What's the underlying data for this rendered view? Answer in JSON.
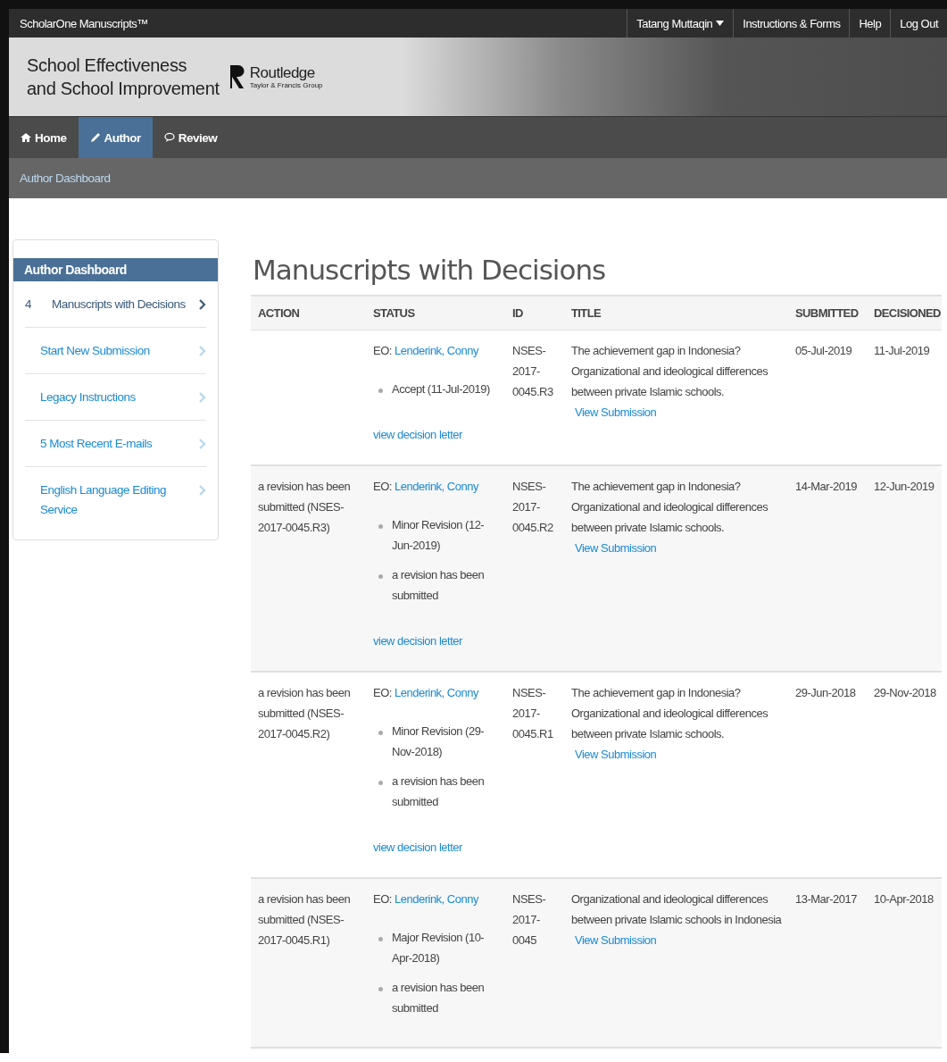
{
  "top_bar": {
    "brand": "ScholarOne Manuscripts™",
    "menu": [
      {
        "label": "Tatang Muttaqin",
        "dropdown": true
      },
      {
        "label": "Instructions & Forms",
        "dropdown": false
      },
      {
        "label": "Help",
        "dropdown": false
      },
      {
        "label": "Log Out",
        "dropdown": false
      }
    ]
  },
  "banner": {
    "journal_lines": [
      "School Effectiveness",
      "and School Improvement"
    ],
    "publisher": "Routledge",
    "publisher_group": "Taylor & Francis Group"
  },
  "nav_tabs": [
    {
      "label": "Home",
      "selected": false
    },
    {
      "label": "Author",
      "selected": true
    },
    {
      "label": "Review",
      "selected": false
    }
  ],
  "breadcrumb": "Author Dashboard",
  "sidebar": {
    "title": "Author Dashboard",
    "items": [
      {
        "count": "4",
        "label": "Manuscripts with Decisions",
        "selected": true
      },
      {
        "label": "Start New Submission",
        "selected": false
      },
      {
        "label": "Legacy Instructions",
        "selected": false
      },
      {
        "label": "5 Most Recent E-mails",
        "selected": false
      },
      {
        "label": "English Language Editing Service",
        "selected": false
      }
    ]
  },
  "heading": "Manuscripts with Decisions",
  "table": {
    "columns": [
      "ACTION",
      "STATUS",
      "ID",
      "TITLE",
      "SUBMITTED",
      "DECISIONED"
    ],
    "rows": [
      {
        "action": "",
        "status_prefix": "EO:",
        "editor": "Lenderink, Conny",
        "status_items": [
          "Accept (11-Jul-2019)"
        ],
        "letter_link": "view decision letter",
        "id": "NSES-2017-0045.R3",
        "title": "The achievement gap in Indonesia? Organizational and ideological differences between private Islamic schools.",
        "view_link": "View Submission",
        "submitted": "05-Jul-2019",
        "decisioned": "11-Jul-2019"
      },
      {
        "action": "a revision has been submitted (NSES-2017-0045.R3)",
        "status_prefix": "EO:",
        "editor": "Lenderink, Conny",
        "status_items": [
          "Minor Revision (12-Jun-2019)",
          "a revision has been submitted"
        ],
        "letter_link": "view decision letter",
        "id": "NSES-2017-0045.R2",
        "title": "The achievement gap in Indonesia? Organizational and ideological differences between private Islamic schools.",
        "view_link": "View Submission",
        "submitted": "14-Mar-2019",
        "decisioned": "12-Jun-2019"
      },
      {
        "action": "a revision has been submitted (NSES-2017-0045.R2)",
        "status_prefix": "EO:",
        "editor": "Lenderink, Conny",
        "status_items": [
          "Minor Revision (29-Nov-2018)",
          "a revision has been submitted"
        ],
        "letter_link": "view decision letter",
        "id": "NSES-2017-0045.R1",
        "title": "The achievement gap in Indonesia? Organizational and ideological differences between private Islamic schools.",
        "view_link": "View Submission",
        "submitted": "29-Jun-2018",
        "decisioned": "29-Nov-2018"
      },
      {
        "action": "a revision has been submitted (NSES-2017-0045.R1)",
        "status_prefix": "EO:",
        "editor": "Lenderink, Conny",
        "status_items": [
          "Major Revision (10-Apr-2018)",
          "a revision has been submitted"
        ],
        "id": "NSES-2017-0045",
        "title": "Organizational and ideological differences between private Islamic schools in Indonesia",
        "view_link": "View Submission",
        "submitted": "13-Mar-2017",
        "decisioned": "10-Apr-2018"
      }
    ]
  }
}
